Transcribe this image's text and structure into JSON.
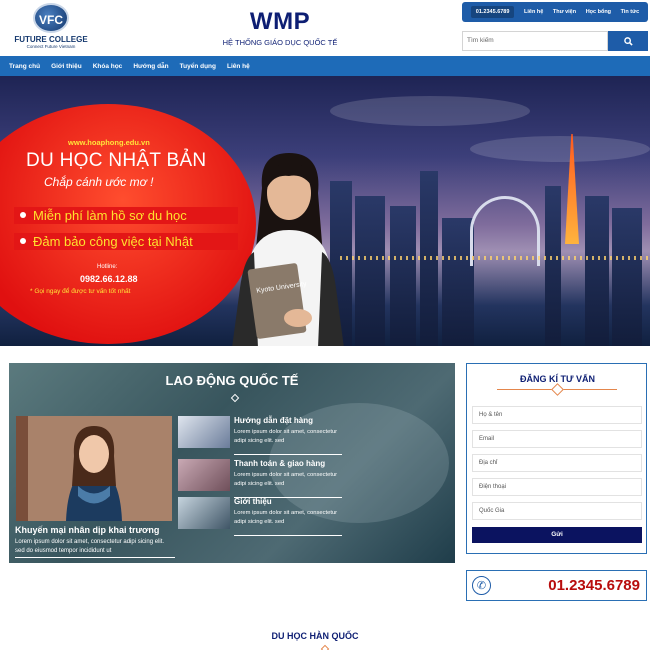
{
  "header": {
    "logo_badge": "VFC",
    "logo_name": "FUTURE COLLEGE",
    "logo_tagline": "Connect Future Vietnam",
    "brand_title": "WMP",
    "brand_subtitle": "HỆ THỐNG GIÁO DỤC QUỐC TẾ",
    "topbar": {
      "hotline": "01.2345.6789",
      "links": [
        "Liên hệ",
        "Thư viện",
        "Học bổng",
        "Tin tức"
      ]
    },
    "search": {
      "placeholder": "Tìm kiếm",
      "icon": "search-icon"
    }
  },
  "nav": {
    "items": [
      "Trang chủ",
      "Giới thiệu",
      "Khóa học",
      "Hướng dẫn",
      "Tuyển dụng",
      "Liên hệ"
    ]
  },
  "banner": {
    "url": "www.hoaphong.edu.vn",
    "title": "DU HỌC NHẬT BẢN",
    "subtitle": "Chắp cánh ước mơ !",
    "bullets": [
      "Miễn phí làm hồ sơ du học",
      "Đảm bảo công việc tại Nhật"
    ],
    "hotline_label": "Hotline:",
    "hotline": "0982.66.12.88",
    "note": "* Gọi ngay để được tư vấn tốt nhất",
    "book_text": "Kyoto University"
  },
  "lao_dong": {
    "title": "LAO ĐỘNG QUỐC TẾ",
    "featured": {
      "title": "Khuyến mại nhân dịp khai trương",
      "desc": "Lorem ipsum dolor sit amet, consectetur adipi sicing elit. sed do eiusmod tempor incididunt ut"
    },
    "items": [
      {
        "title": "Hướng dẫn đặt hàng",
        "desc": "Lorem ipsum dolor sit amet, consectetur adipi sicing elit. sed"
      },
      {
        "title": "Thanh toán & giao hàng",
        "desc": "Lorem ipsum dolor sit amet, consectetur adipi sicing elit. sed"
      },
      {
        "title": "Giới thiệu",
        "desc": "Lorem ipsum dolor sit amet, consectetur adipi sicing elit. sed"
      }
    ]
  },
  "consult_form": {
    "title": "ĐĂNG KÍ TƯ VẤN",
    "fields": [
      "Họ & tên",
      "Email",
      "Địa chỉ",
      "Điện thoại",
      "Quốc Gia"
    ],
    "submit": "Gửi"
  },
  "hotline_box": {
    "number": "01.2345.6789",
    "icon": "phone-icon"
  },
  "next_section": {
    "title": "DU HỌC HÀN QUỐC"
  },
  "colors": {
    "primary": "#1e5ca8",
    "nav": "#1e6bb8",
    "navy": "#0d1e73",
    "hotline_red": "#b80d0d",
    "accent": "#e4864c"
  }
}
